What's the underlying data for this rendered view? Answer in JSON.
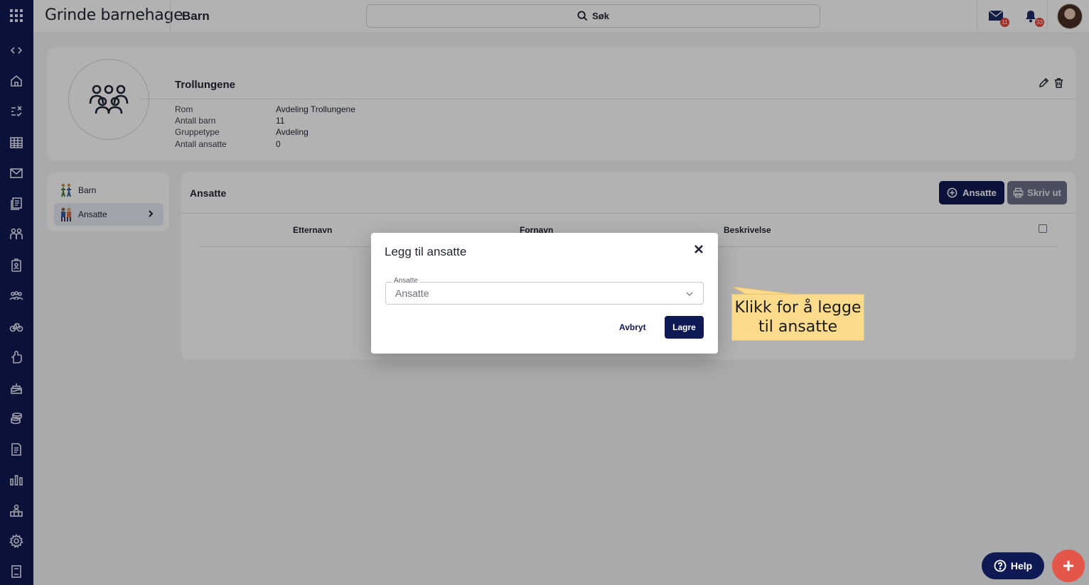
{
  "app": {
    "brand": "Grinde barnehage",
    "section": "Barn"
  },
  "search": {
    "label": "Søk"
  },
  "notifications": {
    "messages_count": "11",
    "alerts_count": "33"
  },
  "group": {
    "name": "Trollungene",
    "details": [
      {
        "label": "Rom",
        "value": "Avdeling Trollungene"
      },
      {
        "label": "Antall barn",
        "value": "11"
      },
      {
        "label": "Gruppetype",
        "value": "Avdeling"
      },
      {
        "label": "Antall ansatte",
        "value": "0"
      }
    ]
  },
  "side_nav": {
    "items": [
      {
        "label": "Barn"
      },
      {
        "label": "Ansatte"
      }
    ]
  },
  "main": {
    "title": "Ansatte",
    "add_button": "Ansatte",
    "print_button": "Skriv ut",
    "columns": [
      "Etternavn",
      "Fornavn",
      "Beskrivelse"
    ]
  },
  "dialog": {
    "title": "Legg til ansatte",
    "field_legend": "Ansatte",
    "field_value": "Ansatte",
    "cancel": "Avbryt",
    "save": "Lagre"
  },
  "callout": {
    "text": "Klikk for å legge til ansatte"
  },
  "fab": {
    "help": "Help",
    "add": "+"
  },
  "colors": {
    "navy": "#0f1a54",
    "accent_red": "#e4554a",
    "callout_yellow": "#fddb8c"
  }
}
